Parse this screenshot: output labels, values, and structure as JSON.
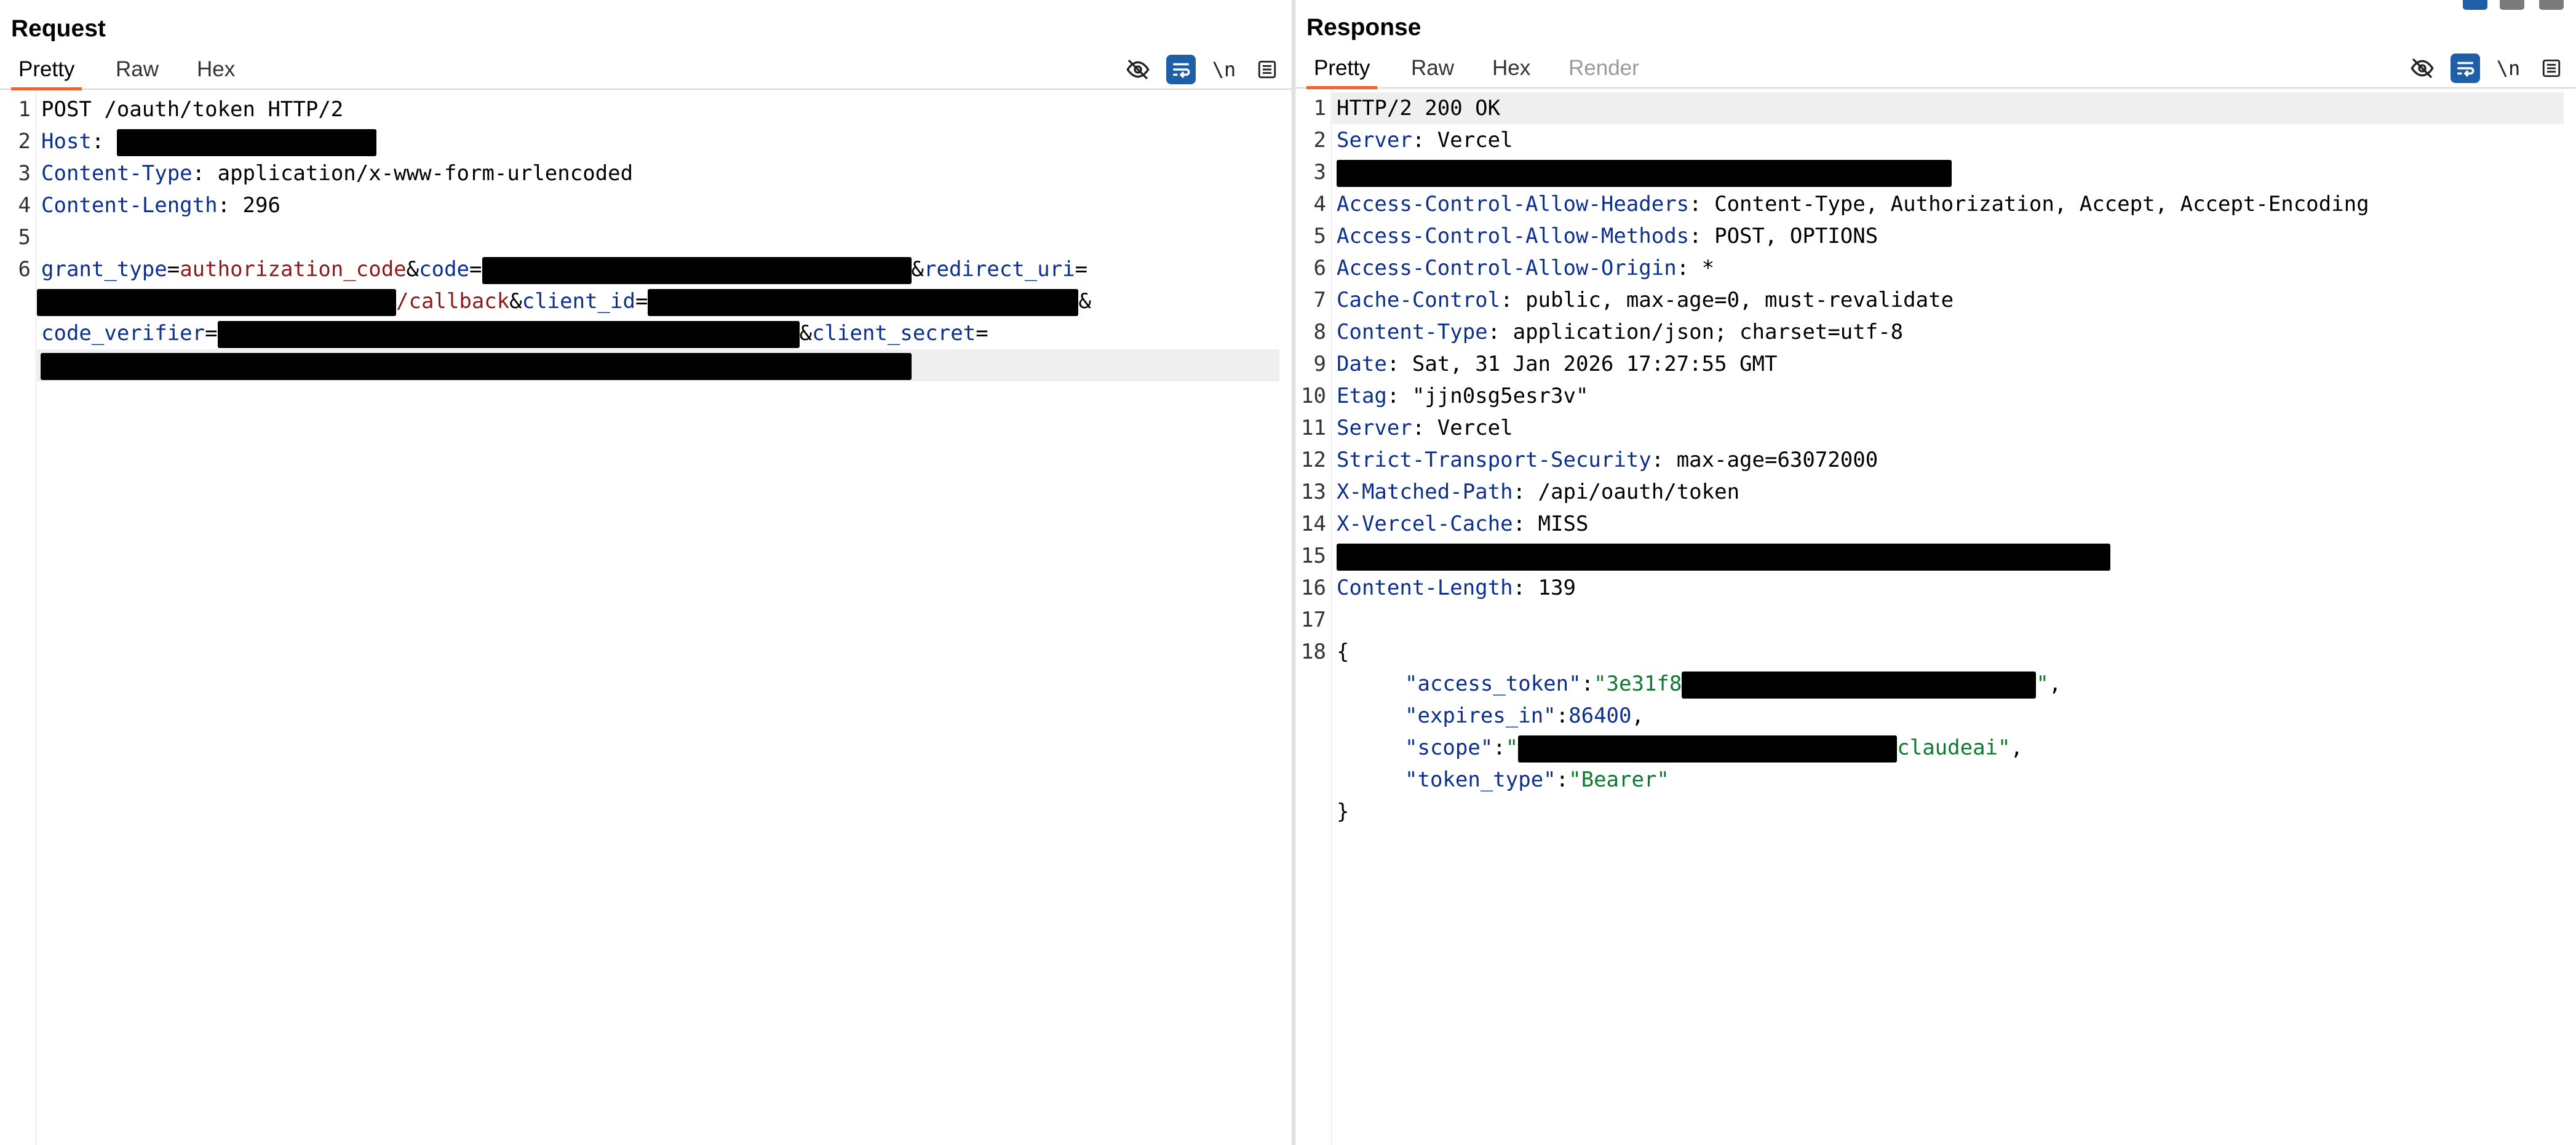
{
  "request": {
    "title": "Request",
    "tabs": [
      "Pretty",
      "Raw",
      "Hex"
    ],
    "tools": {
      "hide_icon": "eye-slash-icon",
      "wrap_icon": "wrap-lines-icon",
      "newline_label": "\\n",
      "menu_icon": "menu-icon"
    },
    "line_numbers": [
      "1",
      "2",
      "3",
      "4",
      "5",
      "6"
    ],
    "lines": {
      "l1": "POST /oauth/token HTTP/2",
      "host_key": "Host",
      "ct_key": "Content-Type",
      "ct_val": "application/x-www-form-urlencoded",
      "cl_key": "Content-Length",
      "cl_val": "296",
      "grant_key": "grant_type",
      "grant_val": "authorization_code",
      "code_key": "code",
      "redirect_key": "redirect_uri",
      "callback": "/callback",
      "client_id_key": "client_id",
      "verifier_key": "code_verifier",
      "secret_key": "client_secret"
    }
  },
  "response": {
    "title": "Response",
    "tabs": [
      "Pretty",
      "Raw",
      "Hex",
      "Render"
    ],
    "tools": {
      "hide_icon": "eye-slash-icon",
      "wrap_icon": "wrap-lines-icon",
      "newline_label": "\\n",
      "menu_icon": "menu-icon"
    },
    "line_numbers": [
      "1",
      "2",
      "3",
      "4",
      "5",
      "6",
      "7",
      "8",
      "9",
      "10",
      "11",
      "12",
      "13",
      "14",
      "15",
      "16",
      "17",
      "18"
    ],
    "status": "HTTP/2 200 OK",
    "headers": [
      {
        "key": "Server",
        "value": "Vercel"
      },
      {
        "key": "Access-Control-Allow-Headers",
        "value": "Content-Type, Authorization, Accept, Accept-Encoding"
      },
      {
        "key": "Access-Control-Allow-Methods",
        "value": "POST, OPTIONS"
      },
      {
        "key": "Access-Control-Allow-Origin",
        "value": "*"
      },
      {
        "key": "Cache-Control",
        "value": "public, max-age=0, must-revalidate"
      },
      {
        "key": "Content-Type",
        "value": "application/json; charset=utf-8"
      },
      {
        "key": "Date",
        "value": "Sat, 31 Jan 2026 17:27:55 GMT"
      },
      {
        "key": "Etag",
        "value": "\"jjn0sg5esr3v\""
      },
      {
        "key": "Server",
        "value": "Vercel"
      },
      {
        "key": "Strict-Transport-Security",
        "value": "max-age=63072000"
      },
      {
        "key": "X-Matched-Path",
        "value": "/api/oauth/token"
      },
      {
        "key": "X-Vercel-Cache",
        "value": "MISS"
      },
      {
        "key": "Content-Length",
        "value": "139"
      }
    ],
    "json": {
      "open": "{",
      "close": "}",
      "access_token_key": "\"access_token\"",
      "access_token_prefix": "\"3e31f8",
      "access_token_suffix": "\"",
      "expires_key": "\"expires_in\"",
      "expires_val": "86400",
      "scope_key": "\"scope\"",
      "scope_prefix": "\"",
      "scope_suffix": "claudeai\"",
      "token_type_key": "\"token_type\"",
      "token_type_val": "\"Bearer\""
    }
  },
  "colors": {
    "accent_tab": "#e8673a",
    "header_key": "#0b2f8a",
    "param_value": "#8b1a1a",
    "json_string": "#0f7a2f",
    "redaction": "#000000",
    "wrap_button": "#1f5fa8"
  }
}
